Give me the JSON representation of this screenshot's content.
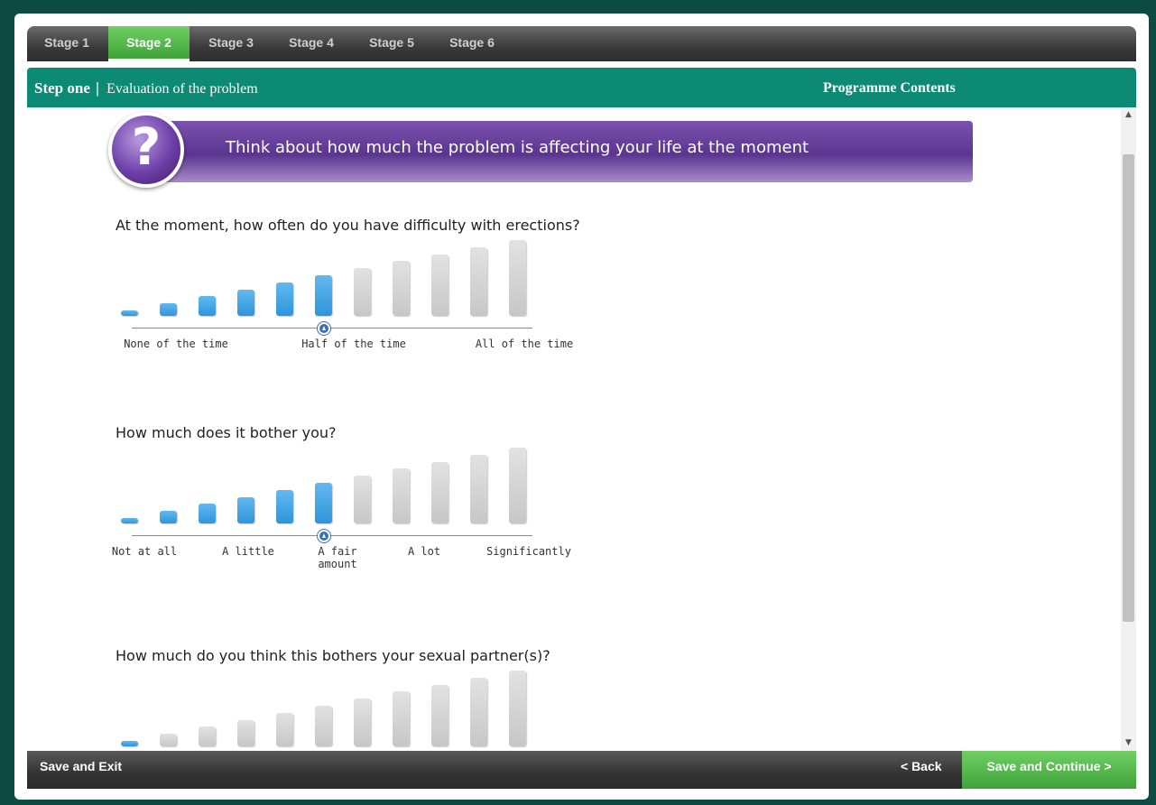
{
  "stages": [
    {
      "label": "Stage 1",
      "active": false
    },
    {
      "label": "Stage 2",
      "active": true
    },
    {
      "label": "Stage 3",
      "active": false
    },
    {
      "label": "Stage 4",
      "active": false
    },
    {
      "label": "Stage 5",
      "active": false
    },
    {
      "label": "Stage 6",
      "active": false
    }
  ],
  "header": {
    "step": "Step one",
    "separator": "|",
    "title": "Evaluation of the problem",
    "contents_link": "Programme Contents"
  },
  "banner": {
    "icon": "question-icon",
    "glyph": "?",
    "text": "Think about how much the problem is affecting your life at the moment"
  },
  "questions": [
    {
      "text": "At the moment, how often do you have difficulty with erections?",
      "bar_count": 11,
      "selected_level": 5,
      "labels": [
        "None of the time",
        "Half of the time",
        "All of the time"
      ]
    },
    {
      "text": "How much does it bother you?",
      "bar_count": 11,
      "selected_level": 5,
      "labels": [
        "Not at all",
        "A little",
        "A fair\namount",
        "A lot",
        "Significantly"
      ]
    },
    {
      "text": "How much do you think this bothers your sexual partner(s)?",
      "bar_count": 11,
      "selected_level": 0,
      "labels": []
    }
  ],
  "footer": {
    "save_exit": "Save and Exit",
    "back": "< Back",
    "continue": "Save and Continue >"
  },
  "colors": {
    "accent_green": "#3fa33a",
    "header_teal": "#0d8a74",
    "banner_purple": "#5a3590",
    "bar_on": "#2e95db",
    "bar_off": "#c7c7c7"
  }
}
